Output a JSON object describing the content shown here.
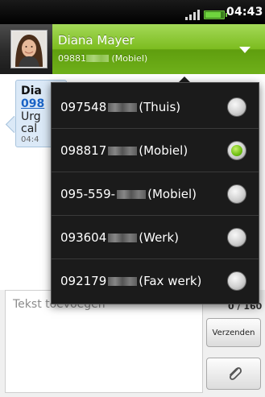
{
  "status_bar": {
    "time": "04:43",
    "signal_icon": "signal-icon",
    "battery_icon": "battery-icon"
  },
  "contact_header": {
    "name": "Diana Mayer",
    "number_visible": "09881",
    "number_type": "(Mobiel)",
    "colors": {
      "accent": "#7cbc1f"
    }
  },
  "conversation": {
    "bubble": {
      "sender": "Dia",
      "number": "098",
      "line1": "Urg",
      "line2": "cal",
      "time": "04:4"
    }
  },
  "compose": {
    "placeholder": "Tekst toevoegen",
    "counter": "0 / 160",
    "send_label": "Verzenden",
    "attach_icon": "paperclip-icon"
  },
  "number_picker": {
    "options": [
      {
        "number": "097548",
        "type": "(Thuis)",
        "selected": false
      },
      {
        "number": "098817",
        "type": "(Mobiel)",
        "selected": true
      },
      {
        "number": "095-559-",
        "type": "(Mobiel)",
        "selected": false
      },
      {
        "number": "093604",
        "type": "(Werk)",
        "selected": false
      },
      {
        "number": "092179",
        "type": "(Fax werk)",
        "selected": false
      }
    ]
  }
}
